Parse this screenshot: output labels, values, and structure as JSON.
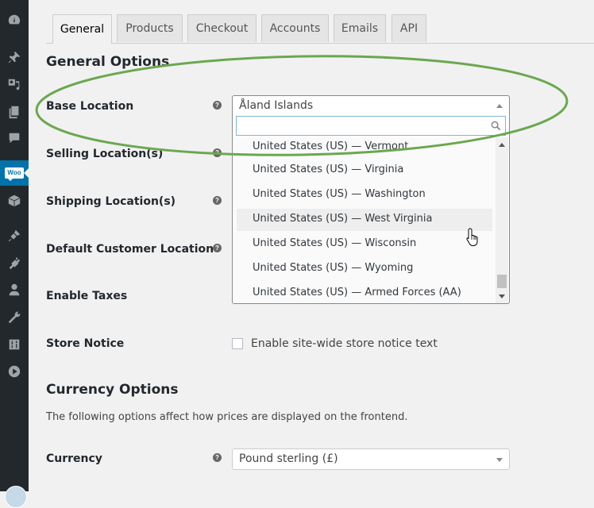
{
  "sidebar": {
    "items": [
      {
        "icon": "dashboard-icon"
      },
      {
        "icon": "pin-icon"
      },
      {
        "icon": "media-icon"
      },
      {
        "icon": "pages-icon"
      },
      {
        "icon": "comments-icon"
      },
      {
        "icon": "woocommerce-icon",
        "label": "Woo",
        "active": true
      },
      {
        "icon": "products-box-icon"
      },
      {
        "icon": "appearance-brush-icon"
      },
      {
        "icon": "plugins-icon"
      },
      {
        "icon": "users-icon"
      },
      {
        "icon": "tools-wrench-icon"
      },
      {
        "icon": "settings-icon"
      },
      {
        "icon": "media-play-icon"
      }
    ]
  },
  "tabs": [
    {
      "label": "General",
      "active": true
    },
    {
      "label": "Products"
    },
    {
      "label": "Checkout"
    },
    {
      "label": "Accounts"
    },
    {
      "label": "Emails"
    },
    {
      "label": "API"
    }
  ],
  "general": {
    "heading": "General Options",
    "fields": {
      "base_location": {
        "label": "Base Location",
        "value": "Åland Islands"
      },
      "selling_locations": {
        "label": "Selling Location(s)"
      },
      "shipping_locations": {
        "label": "Shipping Location(s)"
      },
      "default_customer_location": {
        "label": "Default Customer Location"
      },
      "enable_taxes": {
        "label": "Enable Taxes"
      },
      "store_notice": {
        "label": "Store Notice",
        "checkbox_label": "Enable site-wide store notice text",
        "checked": false
      }
    },
    "help_glyph": "?"
  },
  "dropdown": {
    "search_value": "",
    "options": [
      "United States (US) — Vermont",
      "United States (US) — Virginia",
      "United States (US) — Washington",
      "United States (US) — West Virginia",
      "United States (US) — Wisconsin",
      "United States (US) — Wyoming",
      "United States (US) — Armed Forces (AA)"
    ],
    "hovered_index": 3
  },
  "currency": {
    "heading": "Currency Options",
    "description": "The following options affect how prices are displayed on the frontend.",
    "label": "Currency",
    "value": "Pound sterling (£)"
  },
  "annotation": {
    "color": "#6aa84f"
  }
}
